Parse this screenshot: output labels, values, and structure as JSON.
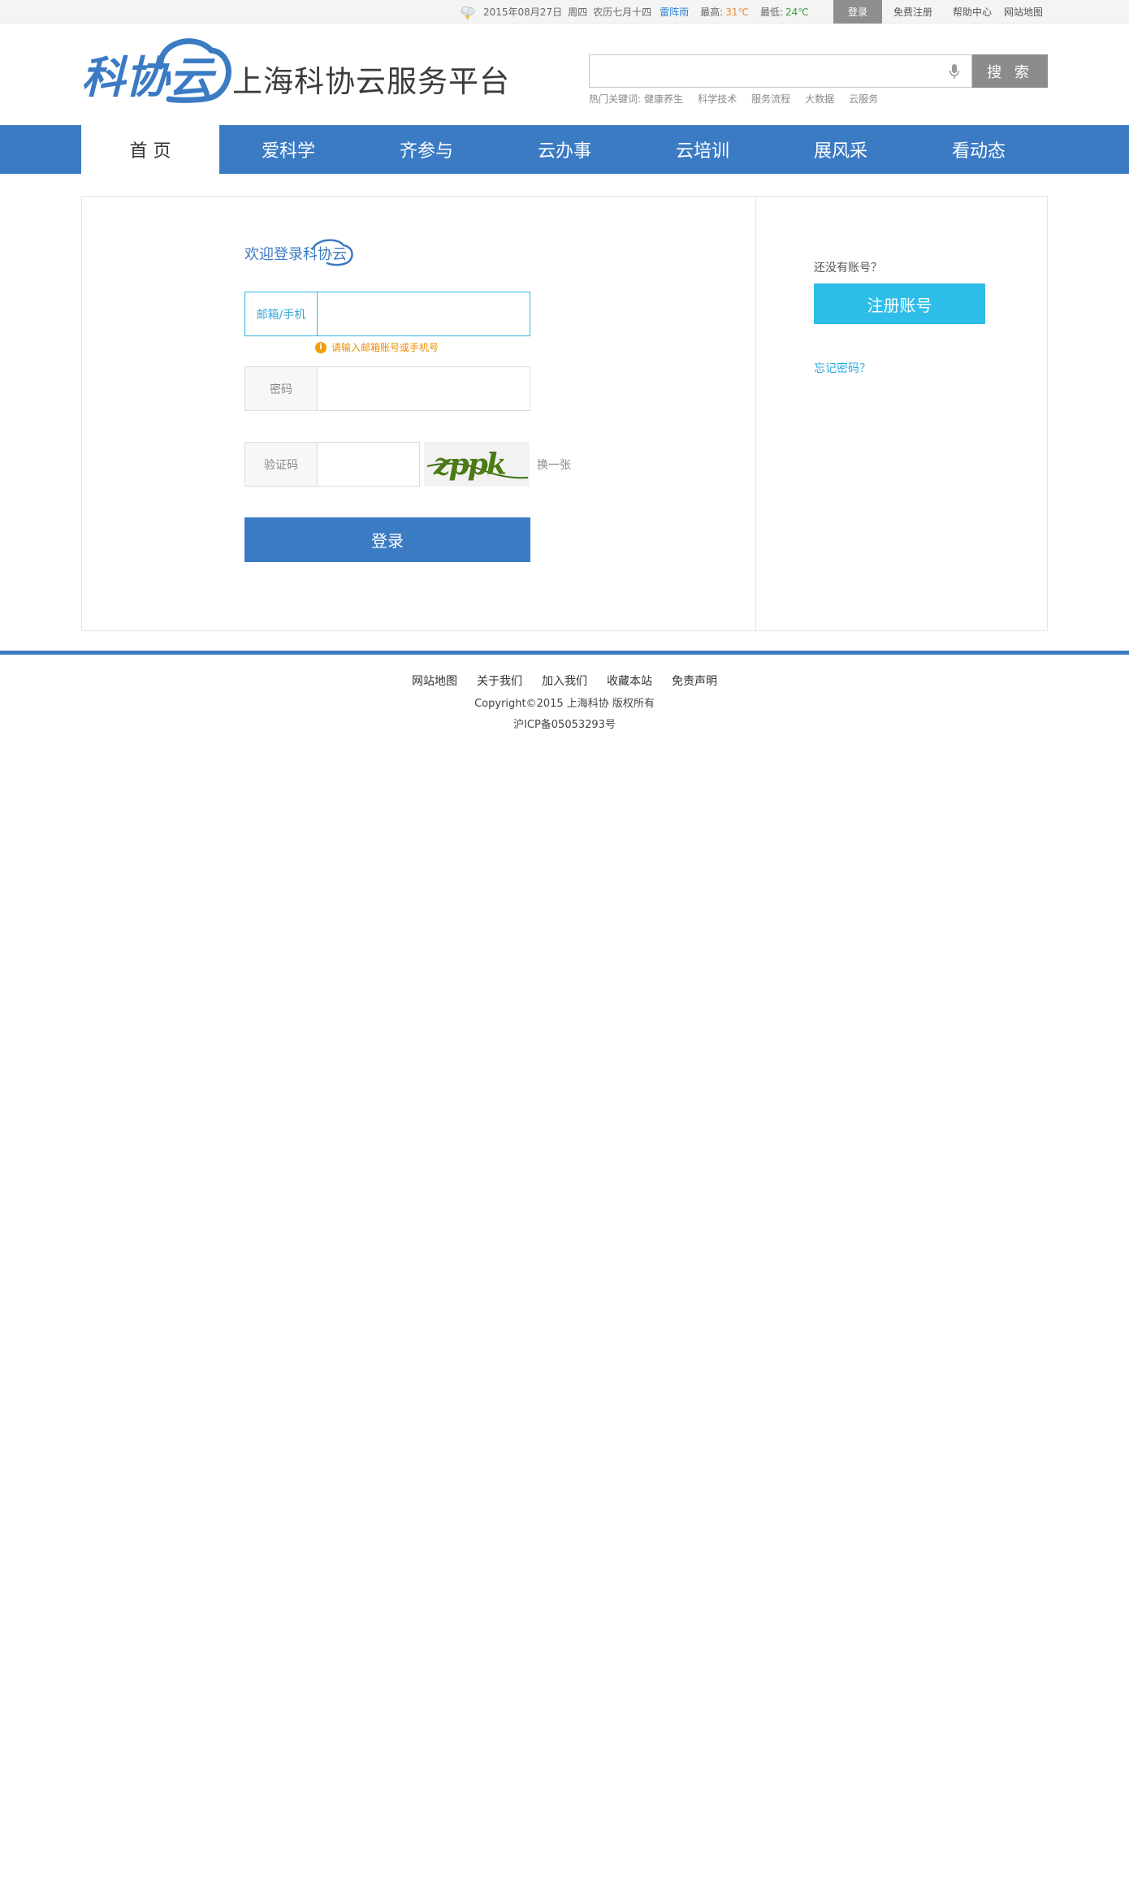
{
  "topbar": {
    "date": "2015年08月27日",
    "weekday": "周四",
    "lunar": "农历七月十四",
    "weather_condition": "雷阵雨",
    "high_label": "最高:",
    "high_temp": "31℃",
    "low_label": "最低:",
    "low_temp": "24℃",
    "login_tab": "登录",
    "register_link": "免费注册",
    "help_link": "帮助中心",
    "sitemap_link": "网站地图"
  },
  "header": {
    "logo_alt": "科协云",
    "platform_name": "上海科协云服务平台",
    "search_placeholder": "",
    "search_button": "搜 索",
    "hotwords_label": "热门关键词:",
    "hotwords": [
      "健康养生",
      "科学技术",
      "服务流程",
      "大数据",
      "云服务"
    ]
  },
  "nav": {
    "items": [
      "首 页",
      "爱科学",
      "齐参与",
      "云办事",
      "云培训",
      "展风采",
      "看动态"
    ],
    "active_index": 0
  },
  "login_form": {
    "welcome": "欢迎登录科协云",
    "email_label": "邮箱/手机",
    "email_value": "",
    "email_hint": "请输入邮箱账号或手机号",
    "password_label": "密码",
    "password_value": "",
    "captcha_label": "验证码",
    "captcha_value": "",
    "captcha_text": "zppk",
    "refresh_link": "换一张",
    "submit": "登录"
  },
  "side": {
    "no_account": "还没有账号？",
    "register_button": "注册账号",
    "forgot_link": "忘记密码？"
  },
  "footer": {
    "links": [
      "网站地图",
      "关于我们",
      "加入我们",
      "收藏本站",
      "免责声明"
    ],
    "copyright": "Copyright©2015 上海科协 版权所有",
    "icp": "沪ICP备05053293号"
  },
  "colors": {
    "brand_blue": "#3b7bc4",
    "accent_cyan": "#2ebde8",
    "hint_orange": "#f08c00",
    "topbar_bg": "#f4f4f4"
  }
}
